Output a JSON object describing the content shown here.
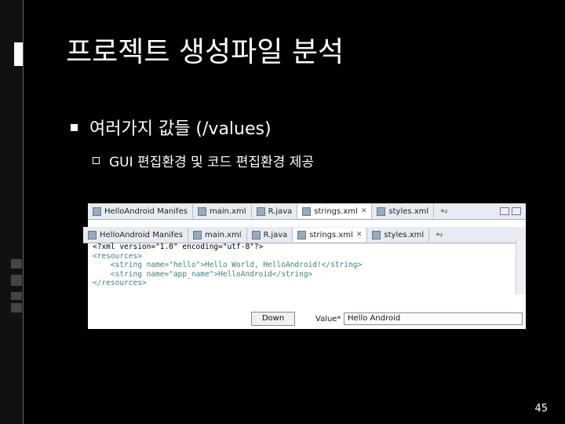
{
  "slide": {
    "title": "프로젝트 생성파일 분석",
    "bullet1": "여러가지 값들 (/values)",
    "bullet2": "GUI 편집환경 및 코드 편집환경 제공",
    "page_number": "45"
  },
  "editor": {
    "tabs_back": [
      {
        "label": "HelloAndroid Manifes"
      },
      {
        "label": "main.xml"
      },
      {
        "label": "R.java"
      },
      {
        "label": "strings.xml"
      },
      {
        "label": "styles.xml"
      }
    ],
    "tabs_front": [
      {
        "label": "HelloAndroid Manifes"
      },
      {
        "label": "main.xml"
      },
      {
        "label": "R.java"
      },
      {
        "label": "strings.xml"
      },
      {
        "label": "styles.xml"
      }
    ],
    "overflow": "»₂",
    "code_lines": [
      "<?xml version=\"1.0\" encoding=\"utf-8\"?>",
      "<resources>",
      "    <string name=\"hello\">Hello World, HelloAndroid!</string>",
      "    <string name=\"app_name\">HelloAndroid</string>",
      "</resources>"
    ],
    "down_button": "Down",
    "value_label": "Value*",
    "value_field": "Hello Android"
  }
}
